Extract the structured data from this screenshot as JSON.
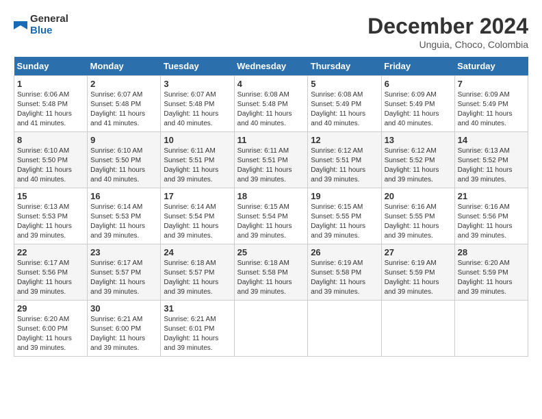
{
  "logo": {
    "text1": "General",
    "text2": "Blue"
  },
  "title": "December 2024",
  "location": "Unguia, Choco, Colombia",
  "days_of_week": [
    "Sunday",
    "Monday",
    "Tuesday",
    "Wednesday",
    "Thursday",
    "Friday",
    "Saturday"
  ],
  "weeks": [
    [
      {
        "day": "1",
        "sunrise": "6:06 AM",
        "sunset": "5:48 PM",
        "daylight": "11 hours and 41 minutes."
      },
      {
        "day": "2",
        "sunrise": "6:07 AM",
        "sunset": "5:48 PM",
        "daylight": "11 hours and 41 minutes."
      },
      {
        "day": "3",
        "sunrise": "6:07 AM",
        "sunset": "5:48 PM",
        "daylight": "11 hours and 40 minutes."
      },
      {
        "day": "4",
        "sunrise": "6:08 AM",
        "sunset": "5:48 PM",
        "daylight": "11 hours and 40 minutes."
      },
      {
        "day": "5",
        "sunrise": "6:08 AM",
        "sunset": "5:49 PM",
        "daylight": "11 hours and 40 minutes."
      },
      {
        "day": "6",
        "sunrise": "6:09 AM",
        "sunset": "5:49 PM",
        "daylight": "11 hours and 40 minutes."
      },
      {
        "day": "7",
        "sunrise": "6:09 AM",
        "sunset": "5:49 PM",
        "daylight": "11 hours and 40 minutes."
      }
    ],
    [
      {
        "day": "8",
        "sunrise": "6:10 AM",
        "sunset": "5:50 PM",
        "daylight": "11 hours and 40 minutes."
      },
      {
        "day": "9",
        "sunrise": "6:10 AM",
        "sunset": "5:50 PM",
        "daylight": "11 hours and 40 minutes."
      },
      {
        "day": "10",
        "sunrise": "6:11 AM",
        "sunset": "5:51 PM",
        "daylight": "11 hours and 39 minutes."
      },
      {
        "day": "11",
        "sunrise": "6:11 AM",
        "sunset": "5:51 PM",
        "daylight": "11 hours and 39 minutes."
      },
      {
        "day": "12",
        "sunrise": "6:12 AM",
        "sunset": "5:51 PM",
        "daylight": "11 hours and 39 minutes."
      },
      {
        "day": "13",
        "sunrise": "6:12 AM",
        "sunset": "5:52 PM",
        "daylight": "11 hours and 39 minutes."
      },
      {
        "day": "14",
        "sunrise": "6:13 AM",
        "sunset": "5:52 PM",
        "daylight": "11 hours and 39 minutes."
      }
    ],
    [
      {
        "day": "15",
        "sunrise": "6:13 AM",
        "sunset": "5:53 PM",
        "daylight": "11 hours and 39 minutes."
      },
      {
        "day": "16",
        "sunrise": "6:14 AM",
        "sunset": "5:53 PM",
        "daylight": "11 hours and 39 minutes."
      },
      {
        "day": "17",
        "sunrise": "6:14 AM",
        "sunset": "5:54 PM",
        "daylight": "11 hours and 39 minutes."
      },
      {
        "day": "18",
        "sunrise": "6:15 AM",
        "sunset": "5:54 PM",
        "daylight": "11 hours and 39 minutes."
      },
      {
        "day": "19",
        "sunrise": "6:15 AM",
        "sunset": "5:55 PM",
        "daylight": "11 hours and 39 minutes."
      },
      {
        "day": "20",
        "sunrise": "6:16 AM",
        "sunset": "5:55 PM",
        "daylight": "11 hours and 39 minutes."
      },
      {
        "day": "21",
        "sunrise": "6:16 AM",
        "sunset": "5:56 PM",
        "daylight": "11 hours and 39 minutes."
      }
    ],
    [
      {
        "day": "22",
        "sunrise": "6:17 AM",
        "sunset": "5:56 PM",
        "daylight": "11 hours and 39 minutes."
      },
      {
        "day": "23",
        "sunrise": "6:17 AM",
        "sunset": "5:57 PM",
        "daylight": "11 hours and 39 minutes."
      },
      {
        "day": "24",
        "sunrise": "6:18 AM",
        "sunset": "5:57 PM",
        "daylight": "11 hours and 39 minutes."
      },
      {
        "day": "25",
        "sunrise": "6:18 AM",
        "sunset": "5:58 PM",
        "daylight": "11 hours and 39 minutes."
      },
      {
        "day": "26",
        "sunrise": "6:19 AM",
        "sunset": "5:58 PM",
        "daylight": "11 hours and 39 minutes."
      },
      {
        "day": "27",
        "sunrise": "6:19 AM",
        "sunset": "5:59 PM",
        "daylight": "11 hours and 39 minutes."
      },
      {
        "day": "28",
        "sunrise": "6:20 AM",
        "sunset": "5:59 PM",
        "daylight": "11 hours and 39 minutes."
      }
    ],
    [
      {
        "day": "29",
        "sunrise": "6:20 AM",
        "sunset": "6:00 PM",
        "daylight": "11 hours and 39 minutes."
      },
      {
        "day": "30",
        "sunrise": "6:21 AM",
        "sunset": "6:00 PM",
        "daylight": "11 hours and 39 minutes."
      },
      {
        "day": "31",
        "sunrise": "6:21 AM",
        "sunset": "6:01 PM",
        "daylight": "11 hours and 39 minutes."
      },
      null,
      null,
      null,
      null
    ]
  ]
}
